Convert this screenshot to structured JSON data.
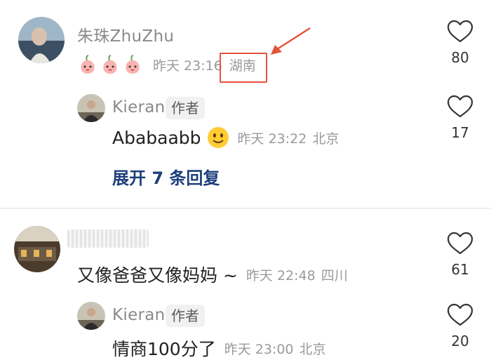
{
  "comments": [
    {
      "username": "朱珠ZhuZhu",
      "time": "昨天 23:16",
      "location": "湖南",
      "likes": "80",
      "reply": {
        "username": "Kieran",
        "tag": "作者",
        "text": "Ababaabb",
        "time": "昨天 23:22",
        "location": "北京",
        "likes": "17"
      },
      "expand_label": "展开 7 条回复"
    },
    {
      "text": "又像爸爸又像妈妈 ~",
      "time": "昨天 22:48",
      "location": "四川",
      "likes": "61",
      "reply": {
        "username": "Kieran",
        "tag": "作者",
        "text": "情商100分了",
        "time": "昨天 23:00",
        "location": "北京",
        "likes": "20"
      }
    }
  ],
  "colors": {
    "annotation": "#e5533a",
    "link": "#1d3f7a"
  },
  "icons": [
    "heart-outline-icon",
    "peach-sticker-icon",
    "smile-emoji-icon",
    "annotation-arrow-icon"
  ]
}
